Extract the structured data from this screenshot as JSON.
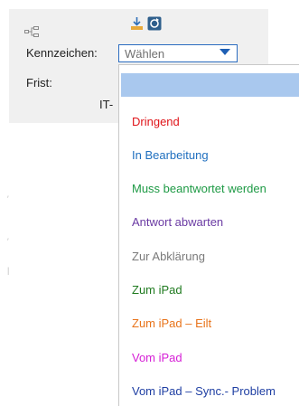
{
  "toolbar": {
    "icons": [
      "connector-icon",
      "download-icon",
      "refresh-icon"
    ],
    "colors": {
      "download": "#e8a93a",
      "refresh": "#2f5f8c"
    }
  },
  "form": {
    "kennzeichen_label": "Kennzeichen:",
    "frist_label": "Frist:",
    "partial_text": "IT-"
  },
  "combo": {
    "value": "Wählen",
    "arrow_color": "#1e5fb4"
  },
  "dropdown": {
    "highlight_color": "#a9c8ee",
    "items": [
      {
        "label": "Dringend",
        "color": "#e0151a"
      },
      {
        "label": "In Bearbeitung",
        "color": "#1f6fbf"
      },
      {
        "label": "Muss beantwortet werden",
        "color": "#1e9a45"
      },
      {
        "label": "Antwort abwarten",
        "color": "#6a3aa3"
      },
      {
        "label": "Zur Abklärung",
        "color": "#7a7a7a"
      },
      {
        "label": "Zum iPad",
        "color": "#1f7a1f"
      },
      {
        "label": "Zum iPad – Eilt",
        "color": "#e8731a"
      },
      {
        "label": "Vom iPad",
        "color": "#d61fd6"
      },
      {
        "label": "Vom iPad – Sync.- Problem",
        "color": "#1f3fa3"
      }
    ]
  }
}
